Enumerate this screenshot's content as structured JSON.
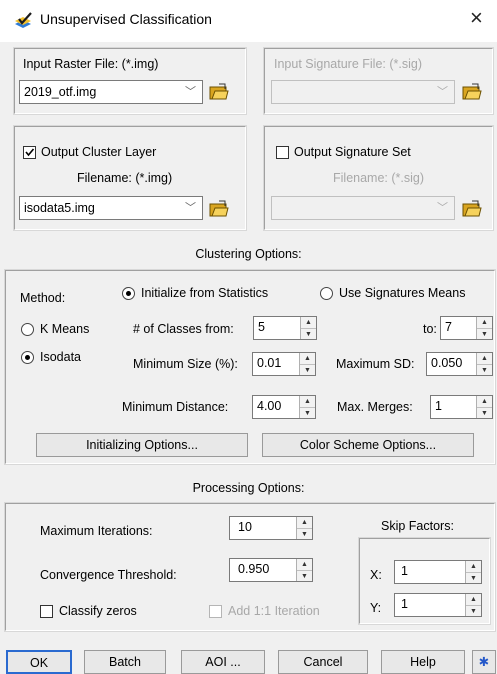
{
  "window": {
    "title": "Unsupervised Classification",
    "close_glyph": "×",
    "app_icon": "layers-checkmark-icon"
  },
  "input_raster": {
    "label": "Input Raster File: (*.img)",
    "value": "2019_otf.img"
  },
  "input_signature": {
    "label": "Input Signature File: (*.sig)",
    "value": ""
  },
  "output_cluster": {
    "checkbox_label": "Output Cluster Layer",
    "checked": true,
    "filename_label": "Filename: (*.img)",
    "value": "isodata5.img"
  },
  "output_signature": {
    "checkbox_label": "Output Signature Set",
    "checked": false,
    "filename_label": "Filename: (*.sig)",
    "value": ""
  },
  "clustering": {
    "header": "Clustering Options:",
    "method_label": "Method:",
    "init_stats_label": "Initialize from Statistics",
    "use_sig_label": "Use Signatures Means",
    "kmeans_label": "K Means",
    "isodata_label": "Isodata",
    "num_classes_label": "# of Classes from:",
    "num_classes_from": "5",
    "to_label": "to:",
    "num_classes_to": "7",
    "min_size_label": "Minimum Size (%):",
    "min_size": "0.01",
    "max_sd_label": "Maximum SD:",
    "max_sd": "0.050",
    "min_distance_label": "Minimum Distance:",
    "min_distance": "4.00",
    "max_merges_label": "Max. Merges:",
    "max_merges": "1",
    "init_options_btn": "Initializing Options...",
    "color_scheme_btn": "Color Scheme Options..."
  },
  "processing": {
    "header": "Processing Options:",
    "max_iter_label": "Maximum Iterations:",
    "max_iter": "10",
    "conv_label": "Convergence Threshold:",
    "conv": "0.950",
    "classify_zeros_label": "Classify zeros",
    "add_iter_label": "Add 1:1 Iteration",
    "skip_label": "Skip Factors:",
    "x_label": "X:",
    "x_value": "1",
    "y_label": "Y:",
    "y_value": "1"
  },
  "buttons": {
    "ok": "OK",
    "batch": "Batch",
    "aoi": "AOI ...",
    "cancel": "Cancel",
    "help": "Help",
    "extra_icon": "asterisk-icon"
  }
}
